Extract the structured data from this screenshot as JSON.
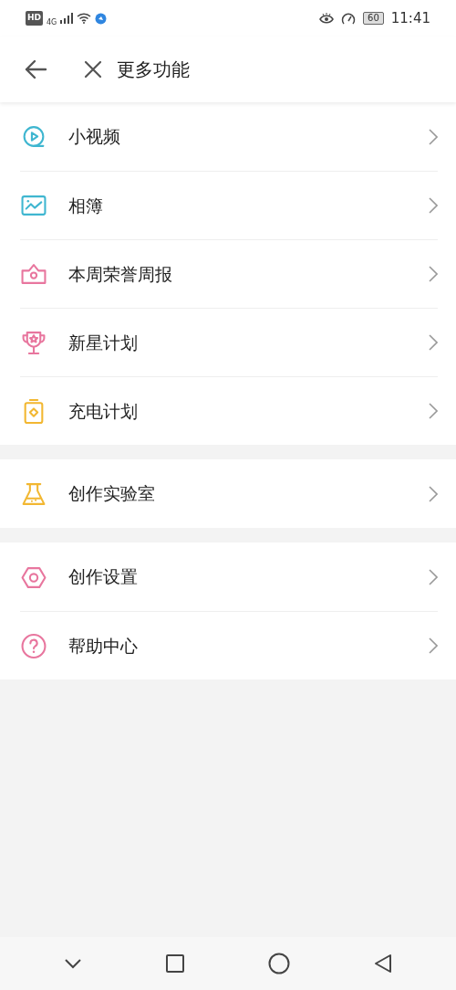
{
  "status_bar": {
    "network_badge": "HD",
    "network_type": "4G",
    "battery": "60",
    "time": "11:41"
  },
  "header": {
    "title": "更多功能"
  },
  "groups": [
    {
      "items": [
        {
          "label": "小视频",
          "kind": "play",
          "color": "#3fb6d0"
        },
        {
          "label": "相簿",
          "kind": "photo",
          "color": "#3fb6d0"
        },
        {
          "label": "本周荣誉周报",
          "kind": "crown",
          "color": "#e8769e"
        },
        {
          "label": "新星计划",
          "kind": "trophy",
          "color": "#e8769e"
        },
        {
          "label": "充电计划",
          "kind": "battery",
          "color": "#f2b731"
        }
      ]
    },
    {
      "items": [
        {
          "label": "创作实验室",
          "kind": "flask",
          "color": "#f2b731"
        }
      ]
    },
    {
      "items": [
        {
          "label": "创作设置",
          "kind": "hexagon",
          "color": "#e8769e"
        },
        {
          "label": "帮助中心",
          "kind": "help",
          "color": "#e8769e"
        }
      ]
    }
  ]
}
